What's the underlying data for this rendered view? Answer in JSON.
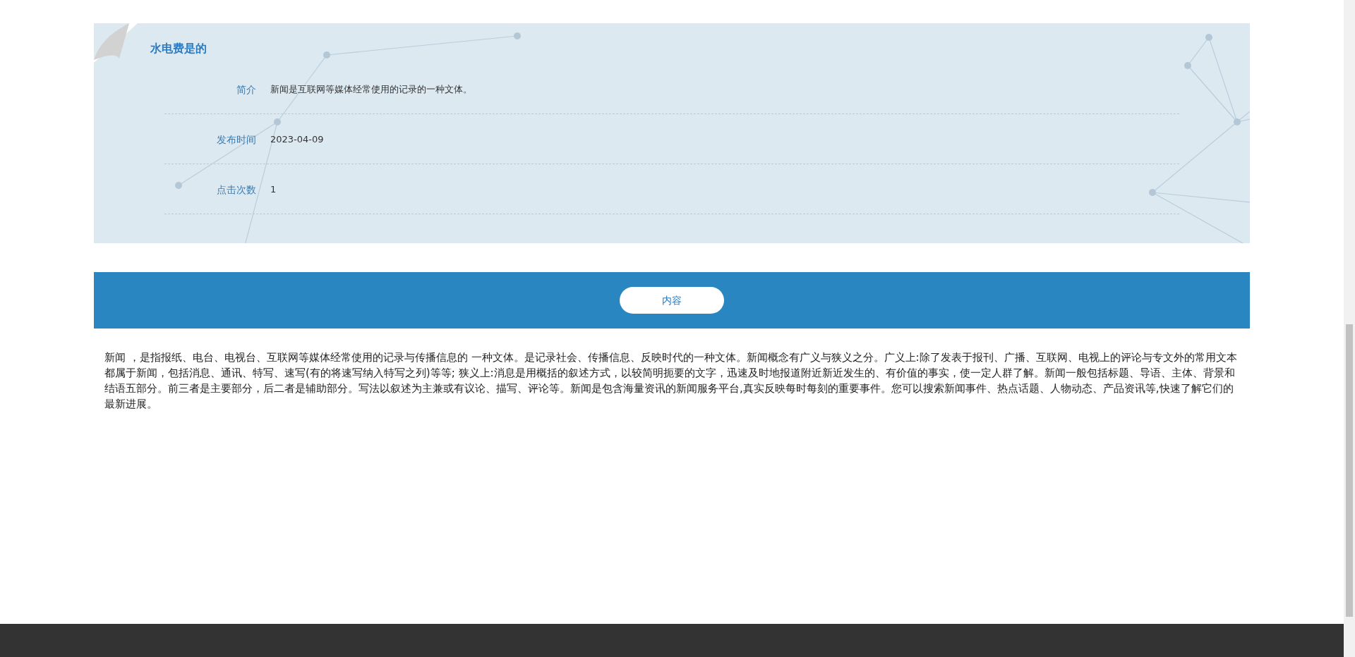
{
  "info_card": {
    "title": "水电费是的",
    "fields": [
      {
        "label": "简介",
        "value": "新闻是互联网等媒体经常使用的记录的一种文体。"
      },
      {
        "label": "发布时间",
        "value": "2023-04-09"
      },
      {
        "label": "点击次数",
        "value": "1"
      }
    ]
  },
  "content_bar": {
    "button": "内容"
  },
  "content_text": "新闻 ，是指报纸、电台、电视台、互联网等媒体经常使用的记录与传播信息的 一种文体。是记录社会、传播信息、反映时代的一种文体。新闻概念有广义与狭义之分。广义上:除了发表于报刊、广播、互联网、电视上的评论与专文外的常用文本都属于新闻，包括消息、通讯、特写、速写(有的将速写纳入特写之列)等等; 狭义上:消息是用概括的叙述方式，以较简明扼要的文字，迅速及时地报道附近新近发生的、有价值的事实，使一定人群了解。新闻一般包括标题、导语、主体、背景和结语五部分。前三者是主要部分，后二者是辅助部分。写法以叙述为主兼或有议论、描写、评论等。新闻是包含海量资讯的新闻服务平台,真实反映每时每刻的重要事件。您可以搜索新闻事件、热点话题、人物动态、产品资讯等,快速了解它们的最新进展。"
}
